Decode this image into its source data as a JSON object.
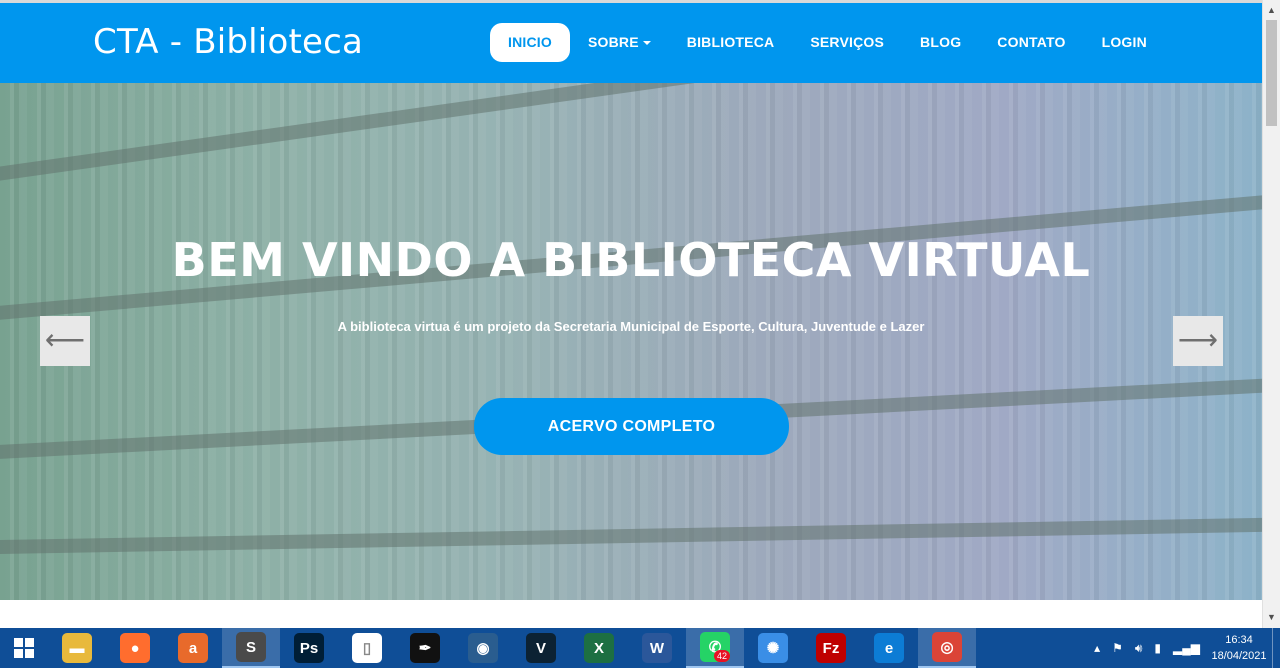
{
  "navbar": {
    "brand": "CTA - Biblioteca",
    "items": [
      {
        "label": "INICIO"
      },
      {
        "label": "SOBRE"
      },
      {
        "label": "BIBLIOTECA"
      },
      {
        "label": "SERVIÇOS"
      },
      {
        "label": "BLOG"
      },
      {
        "label": "CONTATO"
      },
      {
        "label": "LOGIN"
      }
    ],
    "active_item": "INICIO",
    "colors": {
      "bar": "#0096ee",
      "text": "#ffffff"
    }
  },
  "hero": {
    "title": "BEM VINDO A BIBLIOTECA VIRTUAL",
    "subtitle": "A biblioteca virtua é um projeto da Secretaria Municipal de Esporte, Cultura, Juventude e Lazer",
    "cta_label": "ACERVO COMPLETO",
    "prev_icon": "arrow-left-icon",
    "next_icon": "arrow-right-icon",
    "prev_glyph": "⟵",
    "next_glyph": "⟶"
  },
  "taskbar": {
    "apps": [
      {
        "name": "file-explorer",
        "glyph": "▬",
        "color": "#e8b93c"
      },
      {
        "name": "firefox",
        "glyph": "●",
        "color": "#ff6d2e"
      },
      {
        "name": "avast",
        "glyph": "a",
        "color": "#e86a2b"
      },
      {
        "name": "sublime-text",
        "glyph": "S",
        "color": "#4a4a4a"
      },
      {
        "name": "photoshop",
        "glyph": "Ps",
        "color": "#001e36"
      },
      {
        "name": "blank-document",
        "glyph": "▯",
        "color": "#ffffff"
      },
      {
        "name": "inkscape",
        "glyph": "✒",
        "color": "#111111"
      },
      {
        "name": "media-player",
        "glyph": "◉",
        "color": "#2a5d8f"
      },
      {
        "name": "vegas",
        "glyph": "V",
        "color": "#0c2233"
      },
      {
        "name": "excel",
        "glyph": "X",
        "color": "#1d6f42"
      },
      {
        "name": "word",
        "glyph": "W",
        "color": "#2b579a"
      },
      {
        "name": "whatsapp",
        "glyph": "✆",
        "color": "#25d366",
        "badge": "42"
      },
      {
        "name": "app-blue",
        "glyph": "✺",
        "color": "#3a8ee6"
      },
      {
        "name": "filezilla",
        "glyph": "Fz",
        "color": "#bf0000"
      },
      {
        "name": "edge",
        "glyph": "e",
        "color": "#0c7cd5"
      },
      {
        "name": "chrome",
        "glyph": "◎",
        "color": "#db4437"
      }
    ],
    "active_apps": [
      "sublime-text",
      "whatsapp",
      "chrome"
    ],
    "clock": {
      "time": "16:34",
      "date": "18/04/2021"
    }
  }
}
